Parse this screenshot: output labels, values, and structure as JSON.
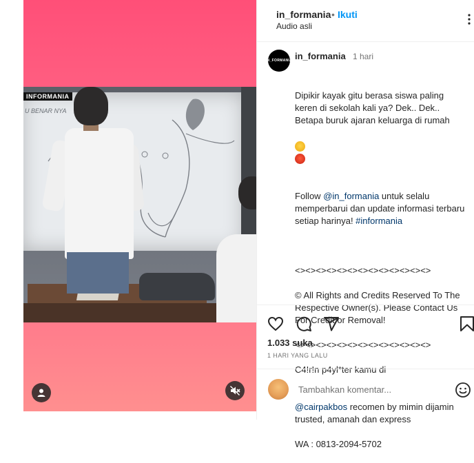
{
  "post": {
    "username": "in_formania",
    "dot": "•",
    "follow_label": "Ikuti",
    "audio_label": "Audio asli",
    "avatar_text": "IN_FORMANIA"
  },
  "video": {
    "overlay_label": "INFORMANIA",
    "board_scrawl": "U BENAR NYA"
  },
  "caption": {
    "username": "in_formania",
    "time": "1 hari",
    "line1": "Dipikir kayak gitu berasa siswa paling keren di sekolah kali ya? Dek.. Dek.. Betapa buruk ajaran keluarga di rumah",
    "follow_prefix": "Follow ",
    "follow_mention": "@in_formania",
    "follow_suffix": " untuk selalu memperbarui dan update informasi terbaru setiap harinya! ",
    "hashtag": "#informania",
    "separator1": "<><><><><><><><><><><><><>",
    "rights": "© All Rights and Credits Reserved To The Respective Owner(s). Please Contact Us For Credit or Removal!",
    "separator2": "<><><><><><><><><><><><><>",
    "promo1": "C4!r!n p4yl*ter kamu di",
    "promo_mention": "@cairpakbos",
    "promo2": " recomen by mimin dijamin trusted, amanah dan express",
    "wa": "WA : 0813-2094-5702"
  },
  "stats": {
    "likes": "1.033 suka",
    "when": "1 HARI YANG LALU"
  },
  "comment": {
    "placeholder": "Tambahkan komentar..."
  },
  "icons": {
    "heart": "heart-icon",
    "comment": "comment-icon",
    "share": "share-icon",
    "save": "bookmark-icon",
    "emoji": "emoji-icon",
    "tagged_user": "user-icon",
    "mute": "mute-icon",
    "more": "more-icon"
  },
  "colors": {
    "accent": "#0095f6",
    "link": "#00376b"
  }
}
